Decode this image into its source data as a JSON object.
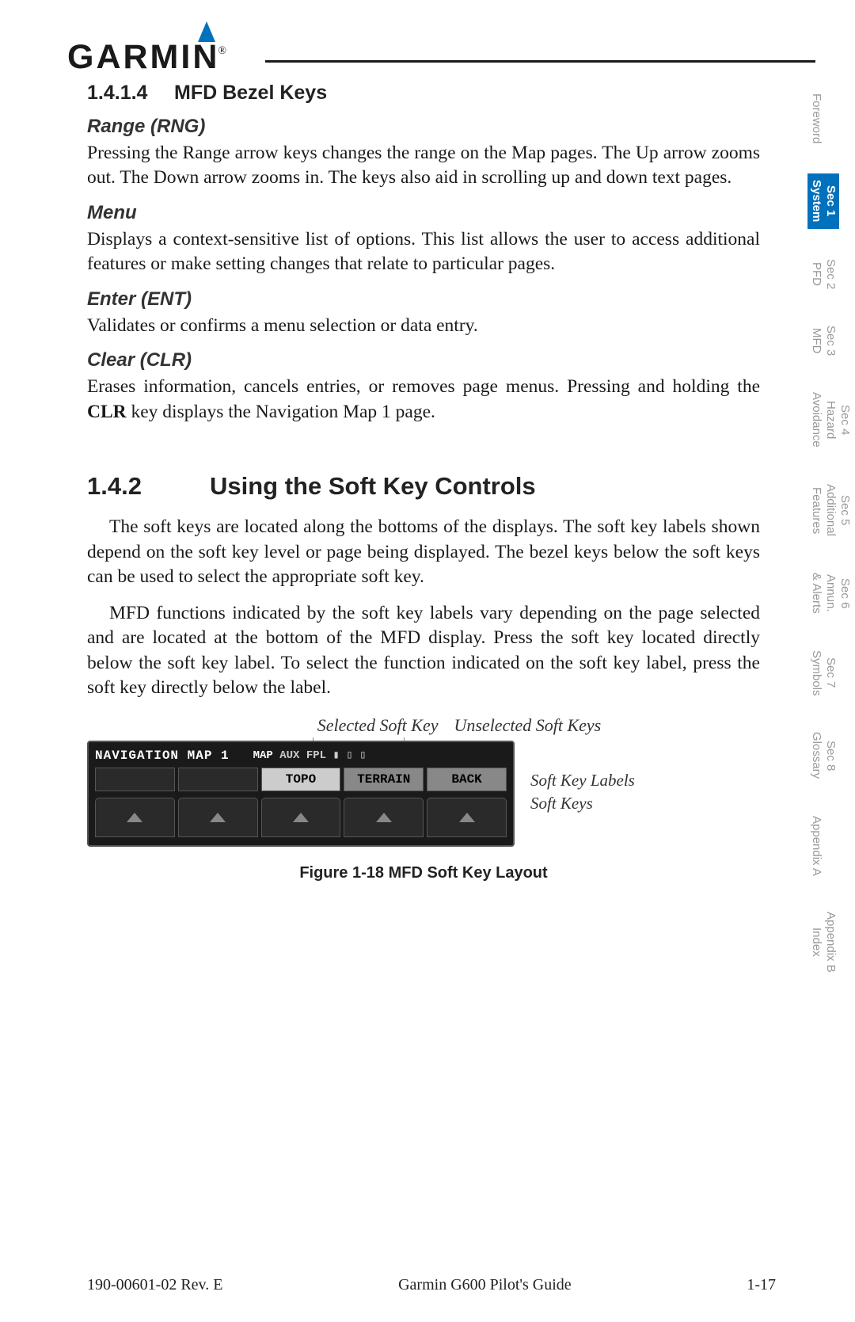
{
  "logo_text": "GARMIN",
  "section_heading": {
    "num": "1.4.1.4",
    "title": "MFD Bezel Keys"
  },
  "range": {
    "heading": "Range (RNG)",
    "body": "Pressing the Range arrow keys changes the range on the Map pages. The Up arrow zooms out. The Down arrow zooms in. The keys also aid in scrolling up and down text pages."
  },
  "menu": {
    "heading": "Menu",
    "body": "Displays a context-sensitive list of options. This list allows the user to access additional features or make setting changes that relate to particular pages."
  },
  "enter": {
    "heading": "Enter (ENT)",
    "body": "Validates or confirms a menu selection or data entry."
  },
  "clear": {
    "heading": "Clear (CLR)",
    "body_pre": "Erases information, cancels entries, or removes page menus. Pressing and holding the ",
    "body_bold": "CLR",
    "body_post": " key displays the Navigation Map 1 page."
  },
  "section2_heading": {
    "num": "1.4.2",
    "title": "Using the Soft Key Controls"
  },
  "section2_p1": "The soft keys are located along the bottoms of the displays. The soft key labels shown depend on the soft key level or page being displayed. The bezel keys below the soft keys can be used to select the appropriate soft key.",
  "section2_p2": "MFD functions indicated by the soft key labels vary depending on the page selected and are located at the bottom of the MFD display. Press the soft key located directly below the soft key label. To select the function indicated on the soft key label, press the soft key directly below the label.",
  "figure": {
    "callout_selected": "Selected Soft Key",
    "callout_unselected": "Unselected Soft Keys",
    "callout_labels": "Soft Key Labels",
    "callout_keys": "Soft Keys",
    "mfd_title": "NAVIGATION MAP 1",
    "mfd_tab_active": "MAP",
    "mfd_tab_rest": "AUX FPL",
    "softkeys": [
      "",
      "",
      "TOPO",
      "TERRAIN",
      "BACK"
    ],
    "caption": "Figure 1-18  MFD Soft Key Layout"
  },
  "side_tabs": [
    {
      "label": "Foreword",
      "active": false
    },
    {
      "label": "Sec 1\nSystem",
      "active": true
    },
    {
      "label": "Sec 2\nPFD",
      "active": false
    },
    {
      "label": "Sec 3\nMFD",
      "active": false
    },
    {
      "label": "Sec 4\nHazard\nAvoidance",
      "active": false
    },
    {
      "label": "Sec 5\nAdditional\nFeatures",
      "active": false
    },
    {
      "label": "Sec 6\nAnnun.\n& Alerts",
      "active": false
    },
    {
      "label": "Sec 7\nSymbols",
      "active": false
    },
    {
      "label": "Sec 8\nGlossary",
      "active": false
    },
    {
      "label": "Appendix A",
      "active": false
    },
    {
      "label": "Appendix B\nIndex",
      "active": false
    }
  ],
  "footer": {
    "left": "190-00601-02  Rev. E",
    "center": "Garmin G600 Pilot's Guide",
    "right": "1-17"
  }
}
